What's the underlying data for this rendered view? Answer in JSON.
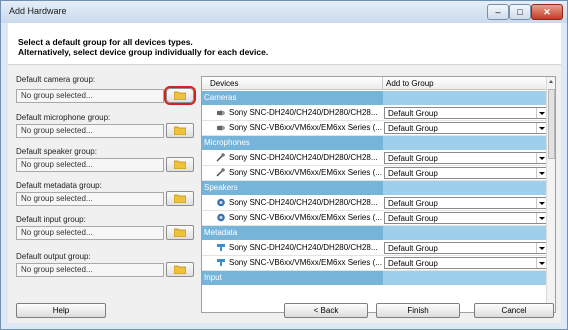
{
  "window": {
    "title": "Add Hardware",
    "controls": [
      "minimize-icon",
      "maximize-icon",
      "close-icon"
    ]
  },
  "header": {
    "line1": "Select a default group for all devices types.",
    "line2": "Alternatively, select device group individually for each device."
  },
  "defaults": [
    {
      "label": "Default camera group:",
      "value": "No group selected..."
    },
    {
      "label": "Default microphone group:",
      "value": "No group selected..."
    },
    {
      "label": "Default speaker group:",
      "value": "No group selected..."
    },
    {
      "label": "Default metadata group:",
      "value": "No group selected..."
    },
    {
      "label": "Default input group:",
      "value": "No group selected..."
    },
    {
      "label": "Default output group:",
      "value": "No group selected..."
    }
  ],
  "grid": {
    "columns": [
      "Devices",
      "Add to Group"
    ],
    "groups": [
      {
        "name": "Cameras",
        "icon": "camera-icon",
        "devices": [
          {
            "name": "Sony SNC-DH240/CH240/DH280/CH28...",
            "group": "Default Group"
          },
          {
            "name": "Sony SNC-VB6xx/VM6xx/EM6xx Series (...",
            "group": "Default Group"
          }
        ]
      },
      {
        "name": "Microphones",
        "icon": "microphone-icon",
        "devices": [
          {
            "name": "Sony SNC-DH240/CH240/DH280/CH28...",
            "group": "Default Group"
          },
          {
            "name": "Sony SNC-VB6xx/VM6xx/EM6xx Series (...",
            "group": "Default Group"
          }
        ]
      },
      {
        "name": "Speakers",
        "icon": "speaker-icon",
        "devices": [
          {
            "name": "Sony SNC-DH240/CH240/DH280/CH28...",
            "group": "Default Group"
          },
          {
            "name": "Sony SNC-VB6xx/VM6xx/EM6xx Series (...",
            "group": "Default Group"
          }
        ]
      },
      {
        "name": "Metadata",
        "icon": "metadata-icon",
        "devices": [
          {
            "name": "Sony SNC-DH240/CH240/DH280/CH28...",
            "group": "Default Group"
          },
          {
            "name": "Sony SNC-VB6xx/VM6xx/EM6xx Series (...",
            "group": "Default Group"
          }
        ]
      },
      {
        "name": "Input",
        "icon": "input-icon",
        "devices": []
      }
    ]
  },
  "footer": {
    "help": "Help",
    "back": "< Back",
    "finish": "Finish",
    "cancel": "Cancel"
  },
  "colors": {
    "group_row": "#76b4da",
    "highlight": "#d6201c"
  }
}
